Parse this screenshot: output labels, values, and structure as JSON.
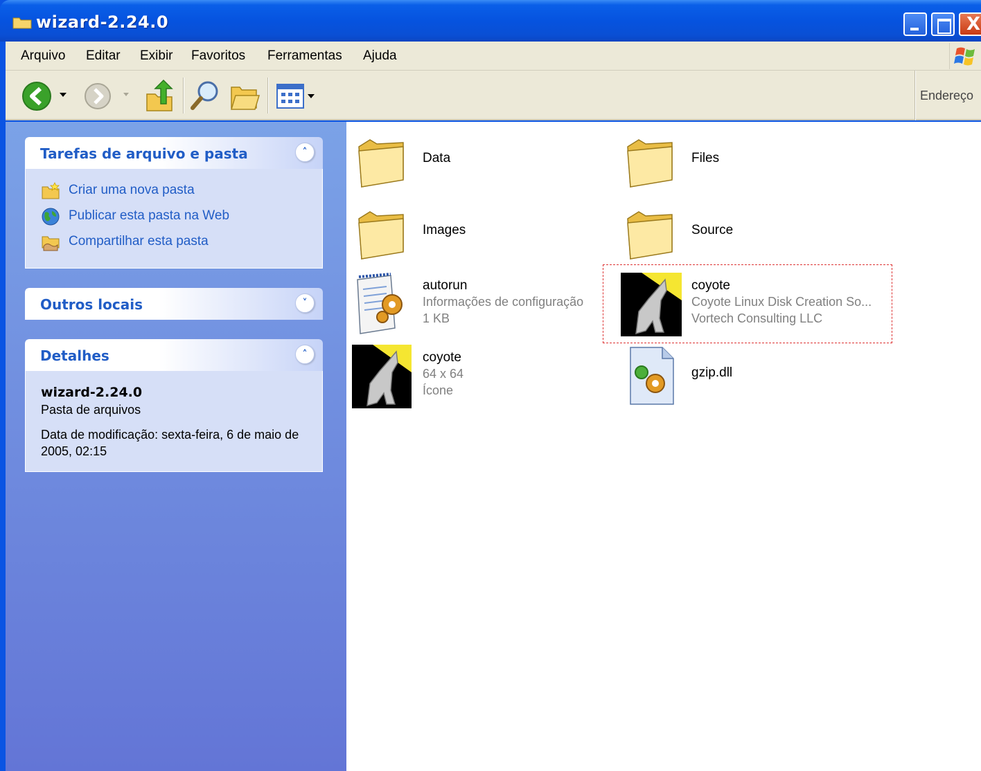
{
  "window": {
    "title": "wizard-2.24.0",
    "close_glyph": "X"
  },
  "menu": [
    "Arquivo",
    "Editar",
    "Exibir",
    "Favoritos",
    "Ferramentas",
    "Ajuda"
  ],
  "toolbar": {
    "address_label": "Endereço",
    "buttons": [
      "back-icon",
      "forward-icon",
      "up-folder-icon",
      "search-icon",
      "folders-icon",
      "views-icon"
    ]
  },
  "taskpane": {
    "file_tasks": {
      "title": "Tarefas de arquivo e pasta",
      "chevron": "˄",
      "items": [
        {
          "label": "Criar uma nova pasta",
          "icon": "new-folder-icon"
        },
        {
          "label": "Publicar esta pasta na Web",
          "icon": "globe-icon"
        },
        {
          "label": "Compartilhar esta pasta",
          "icon": "share-folder-icon"
        }
      ]
    },
    "other_places": {
      "title": "Outros locais",
      "chevron": "˅"
    },
    "details": {
      "title": "Detalhes",
      "chevron": "˄",
      "name": "wizard-2.24.0",
      "type": "Pasta de arquivos",
      "modified": "Data de modificação: sexta-feira, 6 de maio de 2005, 02:15"
    }
  },
  "files": [
    {
      "name": "Data",
      "icon": "folder-icon",
      "lines": []
    },
    {
      "name": "Files",
      "icon": "folder-icon",
      "lines": []
    },
    {
      "name": "Images",
      "icon": "folder-icon",
      "lines": []
    },
    {
      "name": "Source",
      "icon": "folder-icon",
      "lines": []
    },
    {
      "name": "autorun",
      "icon": "config-file-icon",
      "lines": [
        "Informações de configuração",
        "1 KB"
      ]
    },
    {
      "name": "coyote",
      "icon": "coyote-app-icon",
      "lines": [
        "Coyote Linux Disk Creation So...",
        "Vortech Consulting LLC"
      ],
      "selected": true
    },
    {
      "name": "coyote",
      "icon": "coyote-app-icon",
      "lines": [
        "64 x 64",
        "Ícone"
      ]
    },
    {
      "name": "gzip.dll",
      "icon": "dll-file-icon",
      "lines": []
    }
  ]
}
